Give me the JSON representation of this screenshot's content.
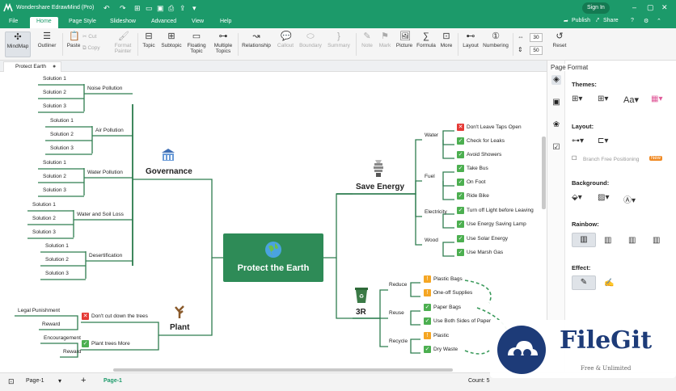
{
  "app": {
    "title": "Wondershare EdrawMind (Pro)",
    "signin": "Sign In",
    "publish": "Publish",
    "share": "Share"
  },
  "menus": [
    "File",
    "Home",
    "Page Style",
    "Slideshow",
    "Advanced",
    "View",
    "Help"
  ],
  "ribbon": {
    "mindmap": "MindMap",
    "outliner": "Outliner",
    "paste": "Paste",
    "cut": "Cut",
    "copy": "Copy",
    "format_painter": "Format Painter",
    "topic": "Topic",
    "subtopic": "Subtopic",
    "floating_topic": "Floating Topic",
    "multiple_topics": "Multiple Topics",
    "relationship": "Relationship",
    "callout": "Callout",
    "boundary": "Boundary",
    "summary": "Summary",
    "note": "Note",
    "mark": "Mark",
    "picture": "Picture",
    "formula": "Formula",
    "more": "More",
    "layout": "Layout",
    "numbering": "Numbering",
    "spin1": "30",
    "spin2": "50",
    "reset": "Reset"
  },
  "doc_tab": "Protect Earth",
  "mindmap": {
    "central": "Protect the Earth",
    "governance": {
      "label": "Governance",
      "items": [
        {
          "label": "Noise Pollution",
          "sols": [
            "Solution 1",
            "Solution 2",
            "Solution 3"
          ]
        },
        {
          "label": "Air Pollution",
          "sols": [
            "Solution 1",
            "Solution 2",
            "Solution 3"
          ]
        },
        {
          "label": "Water Pollution",
          "sols": [
            "Solution 1",
            "Solution 2",
            "Solution 3"
          ]
        },
        {
          "label": "Water and Soil Loss",
          "sols": [
            "Solution 1",
            "Solution 2",
            "Solution 3"
          ]
        },
        {
          "label": "Desertification",
          "sols": [
            "Solution 1",
            "Solution 2",
            "Solution 3"
          ]
        }
      ]
    },
    "plant": {
      "label": "Plant",
      "items": [
        {
          "label": "Don't cut down the trees",
          "sub": [
            "Legal Punishment",
            "Reward"
          ]
        },
        {
          "label": "Plant trees More",
          "sub": [
            "Encouragement",
            "Reward"
          ]
        }
      ]
    },
    "save_energy": {
      "label": "Save Energy",
      "groups": [
        {
          "label": "Water",
          "items": [
            "Don't Leave Taps Open",
            "Check for Leaks",
            "Avoid Showers"
          ]
        },
        {
          "label": "Fuel",
          "items": [
            "Take Bus",
            "On Foot",
            "Ride Bike"
          ]
        },
        {
          "label": "Electricity",
          "items": [
            "Turn off Light before Leaving",
            "Use Energy Saving Lamp"
          ]
        },
        {
          "label": "Wood",
          "items": [
            "Use Solar Energy",
            "Use Marsh Gas"
          ]
        }
      ]
    },
    "three_r": {
      "label": "3R",
      "groups": [
        {
          "label": "Reduce",
          "items": [
            "Plastic Bags",
            "One-off Supplies"
          ]
        },
        {
          "label": "Reuse",
          "items": [
            "Paper Bags",
            "Use Both Sides of Paper"
          ]
        },
        {
          "label": "Recycle",
          "items": [
            "Plastic",
            "Dry Waste"
          ]
        }
      ]
    }
  },
  "panel": {
    "title": "Page Format",
    "themes": "Themes:",
    "layout": "Layout:",
    "branch_free": "Branch Free Positioning",
    "new_badge": "New",
    "background": "Background:",
    "rainbow": "Rainbow:",
    "effect": "Effect:",
    "theme_font": "Aa"
  },
  "status": {
    "page_select": "Page-1",
    "page_tab": "Page-1",
    "count": "Count: 5"
  },
  "watermark": {
    "brand": "FileGit",
    "tagline": "Free & Unlimited"
  },
  "colors": {
    "brand": "#1c9a6a",
    "branch": "#2e7d4f",
    "central": "#2e8b57",
    "check": "#4caf50",
    "cross": "#e53935",
    "warn": "#f5a623"
  }
}
